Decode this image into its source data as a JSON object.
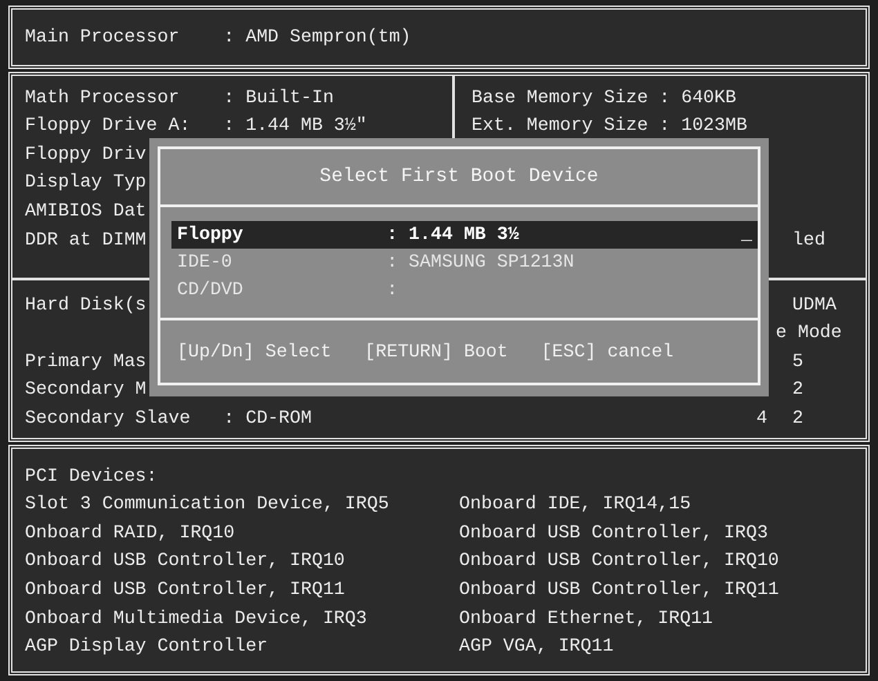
{
  "main_processor": {
    "label": "Main Processor",
    "value": ": AMD Sempron(tm)"
  },
  "system_left": [
    {
      "label": "Math Processor",
      "value": ": Built-In"
    },
    {
      "label": "Floppy Drive A:",
      "value": ": 1.44 MB 3½\""
    },
    {
      "label": "Floppy Driv"
    },
    {
      "label": "Display Typ"
    },
    {
      "label": "AMIBIOS Dat"
    },
    {
      "label": "DDR at DIMM"
    }
  ],
  "system_right": [
    {
      "label": "Base Memory Size",
      "value": ": 640KB"
    },
    {
      "label": "Ext. Memory Size",
      "value": ": 1023MB"
    }
  ],
  "system_right_fragment": "led",
  "hard_disks": {
    "heading": "Hard Disk(s",
    "header_right": [
      "UDMA",
      "e Mode"
    ],
    "rows": [
      {
        "label": "Primary Mas",
        "column_b": "5"
      },
      {
        "label": "Secondary M",
        "column_b": "2"
      },
      {
        "label": "Secondary Slave",
        "value": ": CD-ROM",
        "column_a": "4",
        "column_b": "2"
      }
    ]
  },
  "pci": {
    "heading": "PCI Devices:",
    "left": [
      "Slot 3 Communication Device, IRQ5",
      "Onboard RAID, IRQ10",
      "Onboard USB Controller, IRQ10",
      "Onboard USB Controller, IRQ11",
      "Onboard Multimedia Device, IRQ3",
      "AGP Display Controller"
    ],
    "right": [
      "Onboard IDE, IRQ14,15",
      "Onboard USB Controller, IRQ3",
      "Onboard USB Controller, IRQ10",
      "Onboard USB Controller, IRQ11",
      "Onboard Ethernet, IRQ11",
      "AGP VGA, IRQ11"
    ]
  },
  "dialog": {
    "title": "Select First Boot Device",
    "cursor": "_",
    "devices": [
      {
        "label": "Floppy",
        "value": ": 1.44 MB 3½",
        "selected": true
      },
      {
        "label": "IDE-0",
        "value": ": SAMSUNG SP1213N",
        "selected": false
      },
      {
        "label": "CD/DVD",
        "value": ":",
        "selected": false
      }
    ],
    "hints": [
      "[Up/Dn] Select",
      "[RETURN] Boot",
      "[ESC] cancel"
    ]
  }
}
